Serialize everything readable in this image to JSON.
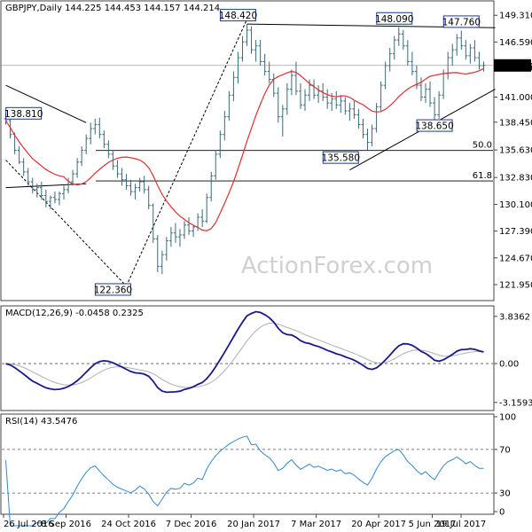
{
  "chart_data": {
    "type": "candlestick",
    "watermark": "ActionForex.com",
    "x_labels": [
      "26 Jul 2016",
      "8 Sep 2016",
      "24 Oct 2016",
      "7 Dec 2016",
      "20 Jan 2017",
      "7 Mar 2017",
      "20 Apr 2017",
      "5 Jun 2017",
      "19 Jul 2017"
    ],
    "colors": {
      "bar": "#3a6a7a",
      "ma": "#e03030",
      "macd": "#1a1a8c",
      "signal": "#b0b0b0",
      "rsi": "#3388cc",
      "line": "#000000",
      "frame": "#444444"
    },
    "panels": {
      "price": {
        "title": "GBPJPY,Daily  144.225 144.453 144.157 144.214",
        "ylim": [
          120.6,
          150.5
        ],
        "ticks": [
          "149.310",
          "146.590",
          "143.970",
          "141.000",
          "138.450",
          "135.630",
          "132.830",
          "130.100",
          "127.390",
          "124.670",
          "121.950"
        ],
        "last_label": "144.214",
        "annotations": [
          {
            "text": "148.420",
            "value": 148.42
          },
          {
            "text": "148.090",
            "value": 148.09
          },
          {
            "text": "147.760",
            "value": 147.76
          },
          {
            "text": "138.810",
            "value": 138.81
          },
          {
            "text": "138.650",
            "value": 138.65
          },
          {
            "text": "135.580",
            "value": 135.58
          },
          {
            "text": "122.360",
            "value": 122.36
          }
        ],
        "fib_levels": [
          {
            "label": "50.0",
            "value": 135.58
          },
          {
            "label": "61.8",
            "value": 132.48
          }
        ],
        "ohlc": [
          [
            138.8,
            139.4,
            138.2,
            138.6
          ],
          [
            138.6,
            138.9,
            136.8,
            137.2
          ],
          [
            137.2,
            137.4,
            135.2,
            135.6
          ],
          [
            135.6,
            136.0,
            134.2,
            134.4
          ],
          [
            134.4,
            134.8,
            133.0,
            133.4
          ],
          [
            133.4,
            133.8,
            132.0,
            132.4
          ],
          [
            132.4,
            132.8,
            131.2,
            131.6
          ],
          [
            131.6,
            132.2,
            130.8,
            131.8
          ],
          [
            131.8,
            132.4,
            130.6,
            131.0
          ],
          [
            131.0,
            131.6,
            129.8,
            130.4
          ],
          [
            130.4,
            131.0,
            129.6,
            130.8
          ],
          [
            130.8,
            131.4,
            130.2,
            130.6
          ],
          [
            130.6,
            131.4,
            130.0,
            131.2
          ],
          [
            131.2,
            132.0,
            130.6,
            131.6
          ],
          [
            131.6,
            132.8,
            131.2,
            132.4
          ],
          [
            132.4,
            133.6,
            132.0,
            133.2
          ],
          [
            133.2,
            134.8,
            132.8,
            134.4
          ],
          [
            134.4,
            136.0,
            134.0,
            135.6
          ],
          [
            135.6,
            137.2,
            135.2,
            136.8
          ],
          [
            136.8,
            138.4,
            136.2,
            137.8
          ],
          [
            137.8,
            138.8,
            137.2,
            138.2
          ],
          [
            138.2,
            138.9,
            136.8,
            137.2
          ],
          [
            137.2,
            137.6,
            135.8,
            136.2
          ],
          [
            136.2,
            136.6,
            134.8,
            135.2
          ],
          [
            135.2,
            135.6,
            133.6,
            134.0
          ],
          [
            134.0,
            134.6,
            132.8,
            133.2
          ],
          [
            133.2,
            133.8,
            132.0,
            132.6
          ],
          [
            132.6,
            133.2,
            131.6,
            132.0
          ],
          [
            132.0,
            132.6,
            131.0,
            131.4
          ],
          [
            131.4,
            132.2,
            130.6,
            131.8
          ],
          [
            131.8,
            132.8,
            131.4,
            132.4
          ],
          [
            132.4,
            133.0,
            131.2,
            131.6
          ],
          [
            131.6,
            132.0,
            129.6,
            130.0
          ],
          [
            130.0,
            130.2,
            126.2,
            126.6
          ],
          [
            126.6,
            127.0,
            123.2,
            123.8
          ],
          [
            123.8,
            125.4,
            123.0,
            125.0
          ],
          [
            125.0,
            126.8,
            124.4,
            126.4
          ],
          [
            126.4,
            127.8,
            125.8,
            127.2
          ],
          [
            127.2,
            128.2,
            126.2,
            126.8
          ],
          [
            126.8,
            127.6,
            125.8,
            127.0
          ],
          [
            127.0,
            128.4,
            126.6,
            128.0
          ],
          [
            128.0,
            128.8,
            127.0,
            127.4
          ],
          [
            127.4,
            128.0,
            126.8,
            127.8
          ],
          [
            127.8,
            129.2,
            127.4,
            128.8
          ],
          [
            128.8,
            129.6,
            127.8,
            128.4
          ],
          [
            128.4,
            131.2,
            128.2,
            130.8
          ],
          [
            130.8,
            133.4,
            130.4,
            133.0
          ],
          [
            133.0,
            135.6,
            132.6,
            135.2
          ],
          [
            135.2,
            137.6,
            134.8,
            137.2
          ],
          [
            137.2,
            139.6,
            136.6,
            139.0
          ],
          [
            139.0,
            141.6,
            138.6,
            141.2
          ],
          [
            141.2,
            143.6,
            140.6,
            143.0
          ],
          [
            143.0,
            145.6,
            142.4,
            145.0
          ],
          [
            145.0,
            147.2,
            144.6,
            146.6
          ],
          [
            146.6,
            148.42,
            146.2,
            147.8
          ],
          [
            147.8,
            148.2,
            145.4,
            145.8
          ],
          [
            145.8,
            146.8,
            144.6,
            146.2
          ],
          [
            146.2,
            146.8,
            144.2,
            144.6
          ],
          [
            144.6,
            145.4,
            143.2,
            143.6
          ],
          [
            143.6,
            144.6,
            142.4,
            142.8
          ],
          [
            142.8,
            143.4,
            141.0,
            141.4
          ],
          [
            141.4,
            142.0,
            138.4,
            139.0
          ],
          [
            139.0,
            140.2,
            137.0,
            139.8
          ],
          [
            139.8,
            142.4,
            139.2,
            141.8
          ],
          [
            141.8,
            143.8,
            141.2,
            143.2
          ],
          [
            143.2,
            144.6,
            141.2,
            141.6
          ],
          [
            141.6,
            142.4,
            139.8,
            140.2
          ],
          [
            140.2,
            141.8,
            139.6,
            141.2
          ],
          [
            141.2,
            142.8,
            140.6,
            142.2
          ],
          [
            142.2,
            142.8,
            140.8,
            141.2
          ],
          [
            141.2,
            142.2,
            140.4,
            141.6
          ],
          [
            141.6,
            142.4,
            140.6,
            141.0
          ],
          [
            141.0,
            141.8,
            139.8,
            140.4
          ],
          [
            140.4,
            141.4,
            139.6,
            140.8
          ],
          [
            140.8,
            141.6,
            139.8,
            140.2
          ],
          [
            140.2,
            141.2,
            139.4,
            140.6
          ],
          [
            140.6,
            141.0,
            139.2,
            139.6
          ],
          [
            139.6,
            140.4,
            138.6,
            139.8
          ],
          [
            139.8,
            140.6,
            138.8,
            139.2
          ],
          [
            139.2,
            139.8,
            137.8,
            138.2
          ],
          [
            138.2,
            138.8,
            136.8,
            137.2
          ],
          [
            137.2,
            137.8,
            135.58,
            136.4
          ],
          [
            136.4,
            138.2,
            136.0,
            137.8
          ],
          [
            137.8,
            140.4,
            137.4,
            140.0
          ],
          [
            140.0,
            142.6,
            139.6,
            142.2
          ],
          [
            142.2,
            144.6,
            141.8,
            144.2
          ],
          [
            144.2,
            146.0,
            143.6,
            145.4
          ],
          [
            145.4,
            147.2,
            144.8,
            146.8
          ],
          [
            146.8,
            148.09,
            146.2,
            147.4
          ],
          [
            147.4,
            147.8,
            145.8,
            146.2
          ],
          [
            146.2,
            146.8,
            144.2,
            144.6
          ],
          [
            144.6,
            145.6,
            143.2,
            143.6
          ],
          [
            143.6,
            144.2,
            141.8,
            142.2
          ],
          [
            142.2,
            143.0,
            140.6,
            141.0
          ],
          [
            141.0,
            142.4,
            140.4,
            141.8
          ],
          [
            141.8,
            142.6,
            140.0,
            140.4
          ],
          [
            140.4,
            141.0,
            138.65,
            139.2
          ],
          [
            139.2,
            141.6,
            138.8,
            141.2
          ],
          [
            141.2,
            143.8,
            140.8,
            143.4
          ],
          [
            143.4,
            145.6,
            142.8,
            145.0
          ],
          [
            145.0,
            146.4,
            144.2,
            145.8
          ],
          [
            145.8,
            147.4,
            145.2,
            147.0
          ],
          [
            147.0,
            147.76,
            145.8,
            146.2
          ],
          [
            146.2,
            146.8,
            144.8,
            145.2
          ],
          [
            145.2,
            146.4,
            144.4,
            146.0
          ],
          [
            146.0,
            146.8,
            144.6,
            145.0
          ],
          [
            145.0,
            145.6,
            143.8,
            144.2
          ],
          [
            144.2,
            144.6,
            143.6,
            144.214
          ]
        ]
      },
      "macd": {
        "title": "MACD(12,26,9) -0.0458 0.2325",
        "ylim": [
          -3.6,
          4.4
        ],
        "ticks": [
          "3.8362",
          "0.00",
          "-3.1593"
        ]
      },
      "rsi": {
        "title": "RSI(14) 43.5476",
        "ylim": [
          13,
          100
        ],
        "ticks": [
          "100",
          "70",
          "30",
          "0"
        ]
      }
    }
  }
}
